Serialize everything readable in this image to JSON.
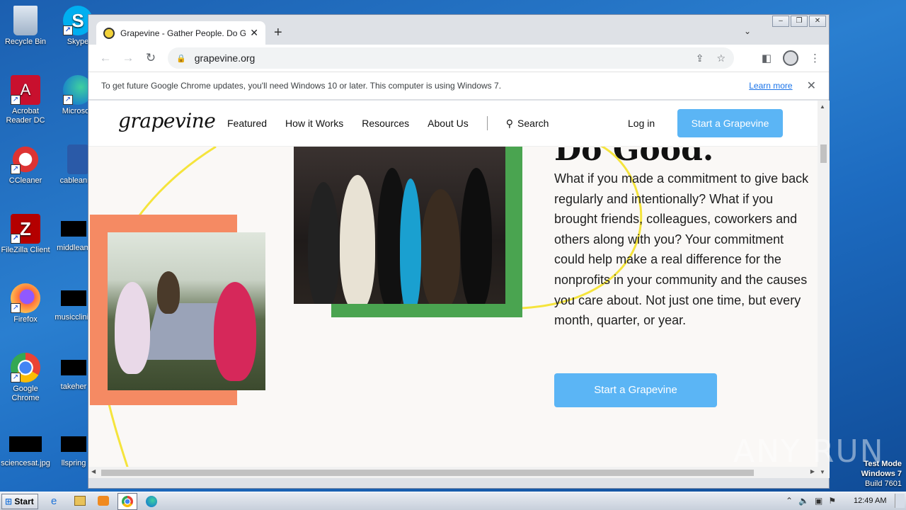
{
  "desktop": {
    "icons": [
      {
        "label": "Recycle Bin"
      },
      {
        "label": "Skype"
      },
      {
        "label": "Acrobat Reader DC"
      },
      {
        "label": "Microsoft"
      },
      {
        "label": "CCleaner"
      },
      {
        "label": "cableannu"
      },
      {
        "label": "FileZilla Client"
      },
      {
        "label": "middleam"
      },
      {
        "label": "Firefox"
      },
      {
        "label": "musicclinic"
      },
      {
        "label": "Google Chrome"
      },
      {
        "label": "takeher"
      },
      {
        "label": "sciencesat.jpg"
      },
      {
        "label": "llspring"
      }
    ],
    "watermark": "ANY RUN",
    "test_mode": [
      "Test Mode",
      "Windows 7",
      "Build 7601"
    ]
  },
  "browser": {
    "tab_title": "Grapevine - Gather People. Do Good",
    "url": "grapevine.org",
    "infobar_text": "To get future Google Chrome updates, you'll need Windows 10 or later. This computer is using Windows 7.",
    "infobar_link": "Learn more"
  },
  "site": {
    "logo": "grapevine",
    "nav": [
      "Featured",
      "How it Works",
      "Resources",
      "About Us"
    ],
    "search_label": "Search",
    "login": "Log in",
    "cta_top": "Start a Grapevine",
    "heading_partial": "Do Good.",
    "body": "What if you made a commitment to give back regularly and intentionally? What if you brought friends, colleagues, coworkers and others along with you? Your commitment could help make a real difference for the nonprofits in your community and the causes you care about. Not just one time, but every month, quarter, or year.",
    "cta_main": "Start a Grapevine",
    "colors": {
      "cta": "#5bb5f5",
      "green_frame": "#4aa450",
      "orange_frame": "#f58a63",
      "yellow_swirl": "#f5e43c"
    }
  },
  "taskbar": {
    "start": "Start",
    "time": "12:49 AM"
  }
}
